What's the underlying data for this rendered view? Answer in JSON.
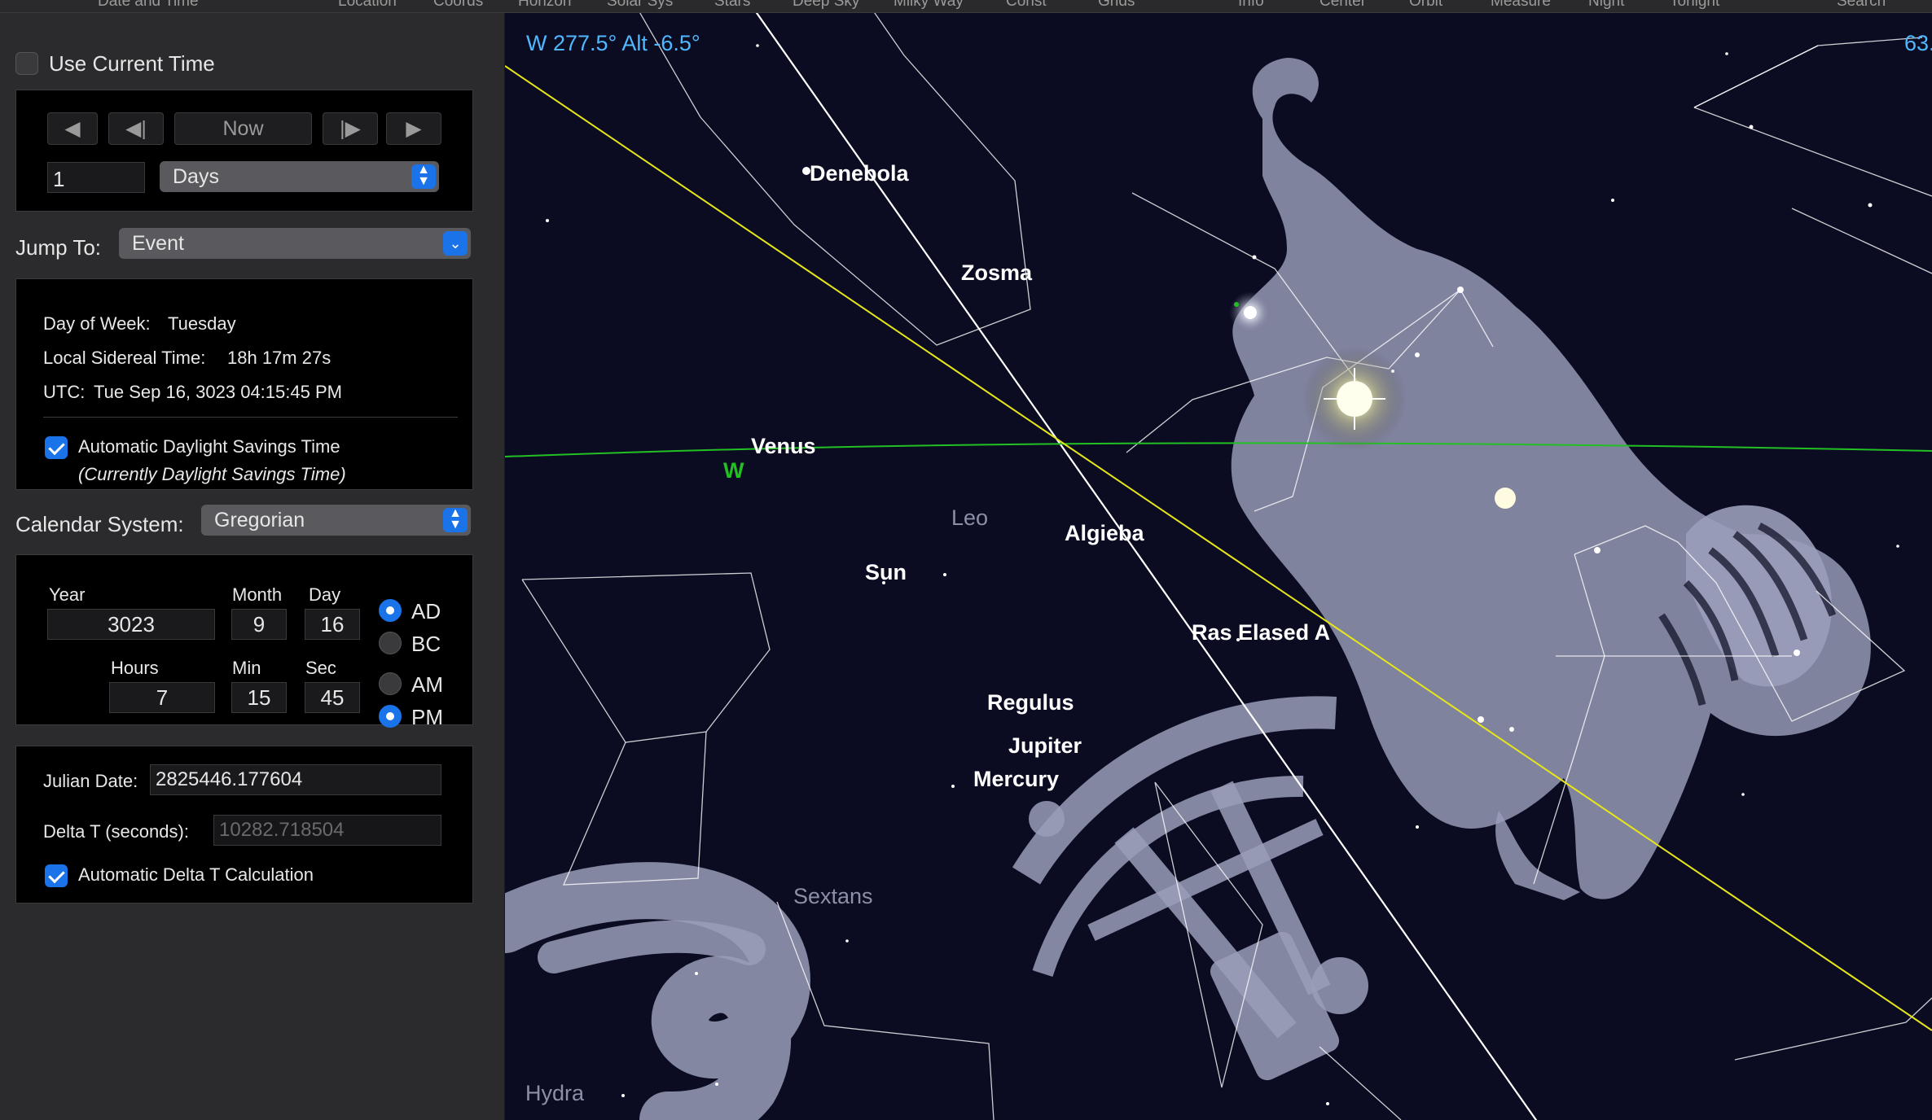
{
  "toolbar": {
    "items": [
      "Date and Time",
      "Location",
      "Coords",
      "Horizon",
      "Solar Sys",
      "Stars",
      "Deep Sky",
      "Milky Way",
      "Const",
      "Grids",
      "Info",
      "Center",
      "Orbit",
      "Measure",
      "Night",
      "Tonight",
      "Search"
    ]
  },
  "panel": {
    "use_current_time": {
      "label": "Use Current Time",
      "checked": false
    },
    "step": {
      "buttons": [
        "◀",
        "◀|",
        "Now",
        "|▶",
        "▶"
      ],
      "amount": "1",
      "unit": "Days"
    },
    "jump_to": {
      "label": "Jump To:",
      "value": "Event"
    },
    "info": {
      "day_of_week_label": "Day of Week:",
      "day_of_week": "Tuesday",
      "lst_label": "Local Sidereal Time:",
      "lst": "18h 17m 27s",
      "utc_label": "UTC:",
      "utc": "Tue Sep 16, 3023  04:15:45 PM",
      "auto_dst_label": "Automatic Daylight Savings Time",
      "auto_dst_checked": true,
      "dst_status": "(Currently Daylight Savings Time)"
    },
    "calendar": {
      "label": "Calendar System:",
      "value": "Gregorian"
    },
    "date": {
      "year_label": "Year",
      "year": "3023",
      "month_label": "Month",
      "month": "9",
      "day_label": "Day",
      "day": "16",
      "ad": "AD",
      "bc": "BC",
      "era": "AD",
      "hours_label": "Hours",
      "hours": "7",
      "min_label": "Min",
      "min": "15",
      "sec_label": "Sec",
      "sec": "45",
      "am": "AM",
      "pm": "PM",
      "meridiem": "PM"
    },
    "julian": {
      "label": "Julian Date:",
      "value": "2825446.177604",
      "delta_label": "Delta T (seconds):",
      "delta_value": "10282.718504",
      "auto_delta_label": "Automatic Delta T Calculation",
      "auto_delta_checked": true
    }
  },
  "sky": {
    "hud_left": "W 277.5° Alt -6.5°",
    "hud_right": "63.",
    "labels": {
      "denebola": "Denebola",
      "zosma": "Zosma",
      "venus": "Venus",
      "w": "W",
      "leo": "Leo",
      "sun": "Sun",
      "algieba": "Algieba",
      "ras_elased": "Ras Elased A",
      "regulus": "Regulus",
      "jupiter": "Jupiter",
      "mercury": "Mercury",
      "sextans": "Sextans",
      "hydra": "Hydra"
    },
    "colors": {
      "background": "#0b0c22",
      "ecliptic": "#e6e619",
      "horizon": "#22c022",
      "meridian": "#ffffff",
      "figure": "#a9acc8",
      "hud": "#4fb8ff"
    }
  }
}
